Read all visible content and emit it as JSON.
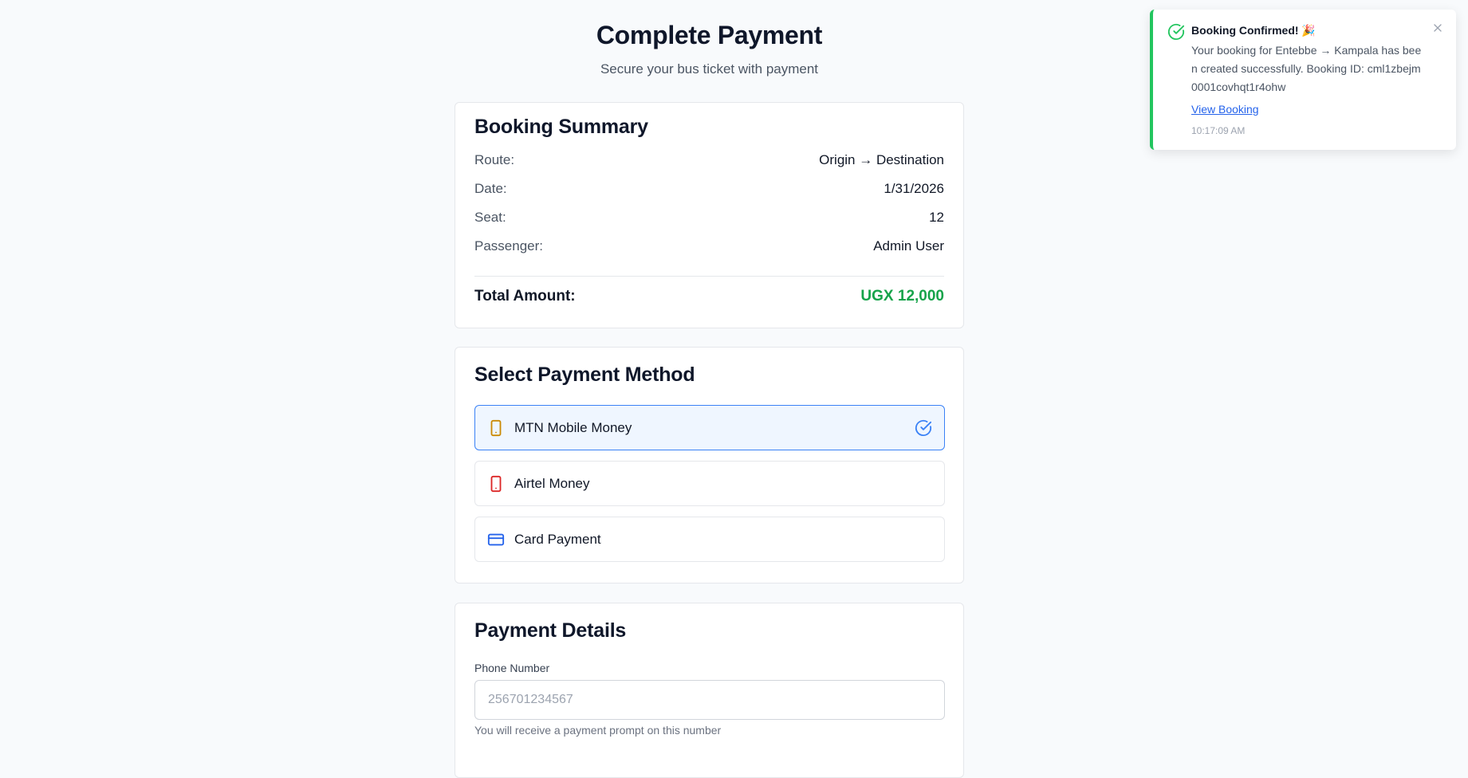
{
  "header": {
    "title": "Complete Payment",
    "subtitle": "Secure your bus ticket with payment"
  },
  "summary": {
    "title": "Booking Summary",
    "rows": [
      {
        "label": "Route:",
        "value": "Origin → Destination"
      },
      {
        "label": "Date:",
        "value": "1/31/2026"
      },
      {
        "label": "Seat:",
        "value": "12"
      },
      {
        "label": "Passenger:",
        "value": "Admin User"
      }
    ],
    "total_label": "Total Amount:",
    "total_value": "UGX 12,000"
  },
  "payment_method": {
    "title": "Select Payment Method",
    "selected": "MTN Mobile Money",
    "options": [
      {
        "label": "MTN Mobile Money",
        "icon": "mobile-phone-icon",
        "color": "#ca8a04"
      },
      {
        "label": "Airtel Money",
        "icon": "mobile-phone-icon",
        "color": "#dc2626"
      },
      {
        "label": "Card Payment",
        "icon": "credit-card-icon",
        "color": "#2563eb"
      }
    ]
  },
  "details": {
    "title": "Payment Details",
    "phone_label": "Phone Number",
    "phone_placeholder": "256701234567",
    "phone_value": "",
    "phone_hint": "You will receive a payment prompt on this number"
  },
  "toast": {
    "title": "Booking Confirmed! 🎉",
    "message": "Your booking for Entebbe → Kampala has been created successfully. Booking ID: cml1zbejm0001covhqt1r4ohw",
    "link": "View Booking",
    "time": "10:17:09 AM"
  },
  "colors": {
    "accent": "#3b82f6",
    "success": "#16a34a",
    "background": "#f8fafc"
  }
}
